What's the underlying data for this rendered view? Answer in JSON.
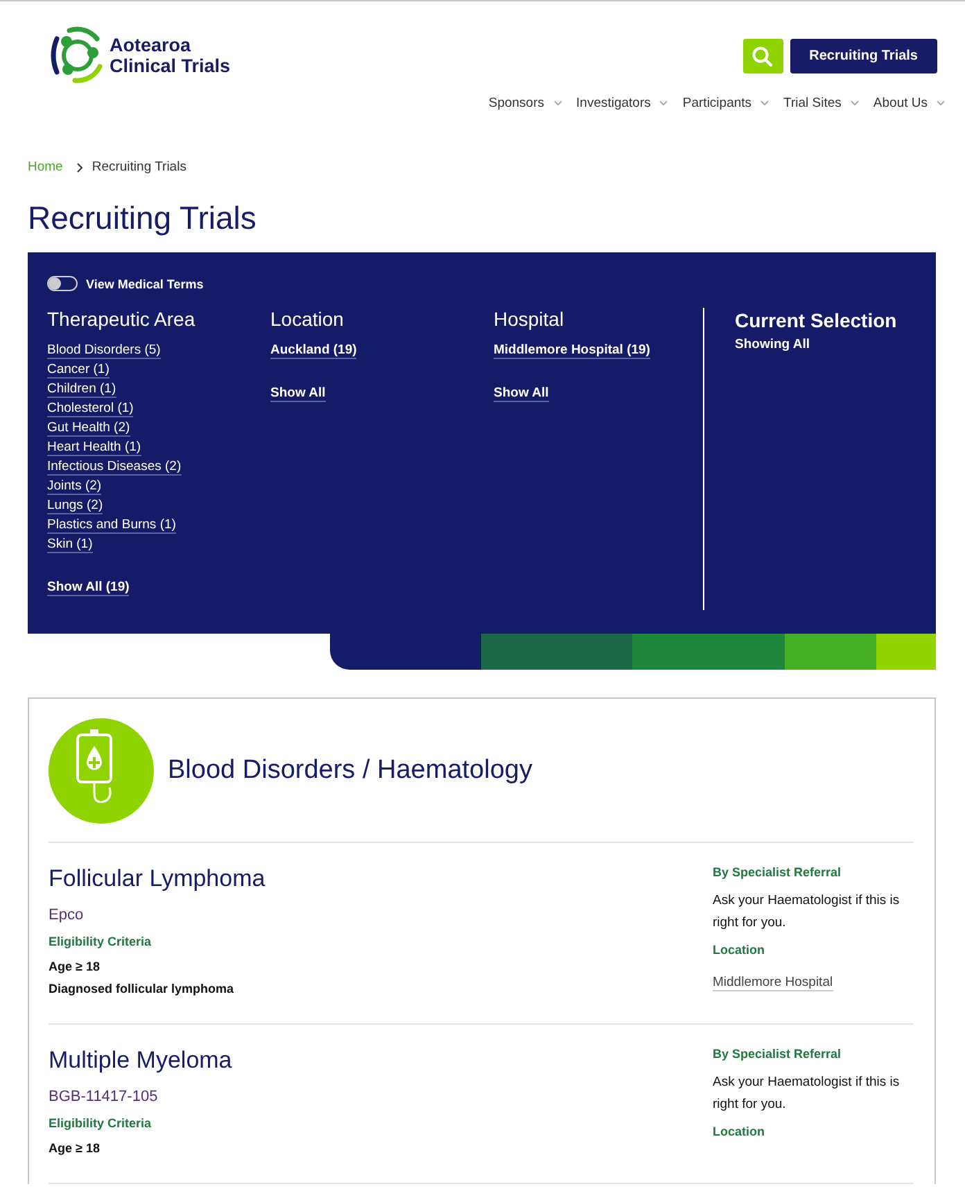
{
  "header": {
    "logo": {
      "line1": "Aotearoa",
      "line2": "Clinical Trials"
    },
    "cta": "Recruiting Trials",
    "nav": [
      "Sponsors",
      "Investigators",
      "Participants",
      "Trial Sites",
      "About Us"
    ]
  },
  "breadcrumb": [
    "Home",
    "Recruiting Trials"
  ],
  "page_title": "Recruiting Trials",
  "filters": {
    "toggle": {
      "label": "View Medical Terms",
      "on": false
    },
    "columns": [
      {
        "heading": "Therapeutic Area",
        "items": [
          "Blood Disorders (5)",
          "Cancer (1)",
          "Children (1)",
          "Cholesterol (1)",
          "Gut Health (2)",
          "Heart Health (1)",
          "Infectious Diseases (2)",
          "Joints (2)",
          "Lungs (2)",
          "Plastics and Burns (1)",
          "Skin (1)"
        ],
        "show_all": "Show All (19)"
      },
      {
        "heading": "Location",
        "items": [
          "Auckland (19)"
        ],
        "show_all": "Show All"
      },
      {
        "heading": "Hospital",
        "items": [
          "Middlemore Hospital (19)"
        ],
        "show_all": "Show All"
      }
    ],
    "current_selection": {
      "heading": "Current Selection",
      "text": "Showing All"
    }
  },
  "category": {
    "title": "Blood Disorders / Haematology",
    "trials": [
      {
        "name": "Follicular Lymphoma",
        "code": "Epco",
        "criteria_heading": "Eligibility Criteria",
        "criteria": [
          "Age ≥ 18",
          "Diagnosed follicular lymphoma"
        ],
        "referral": "By Specialist Referral",
        "referral_text": "Ask your Haematologist if this is right for you.",
        "location_heading": "Location",
        "location": "Middlemore Hospital"
      },
      {
        "name": "Multiple Myeloma",
        "code": "BGB-11417-105",
        "criteria_heading": "Eligibility Criteria",
        "criteria": [
          "Age ≥ 18"
        ],
        "referral": "By Specialist Referral",
        "referral_text": "Ask your Haematologist if this is right for you.",
        "location_heading": "Location"
      }
    ]
  }
}
